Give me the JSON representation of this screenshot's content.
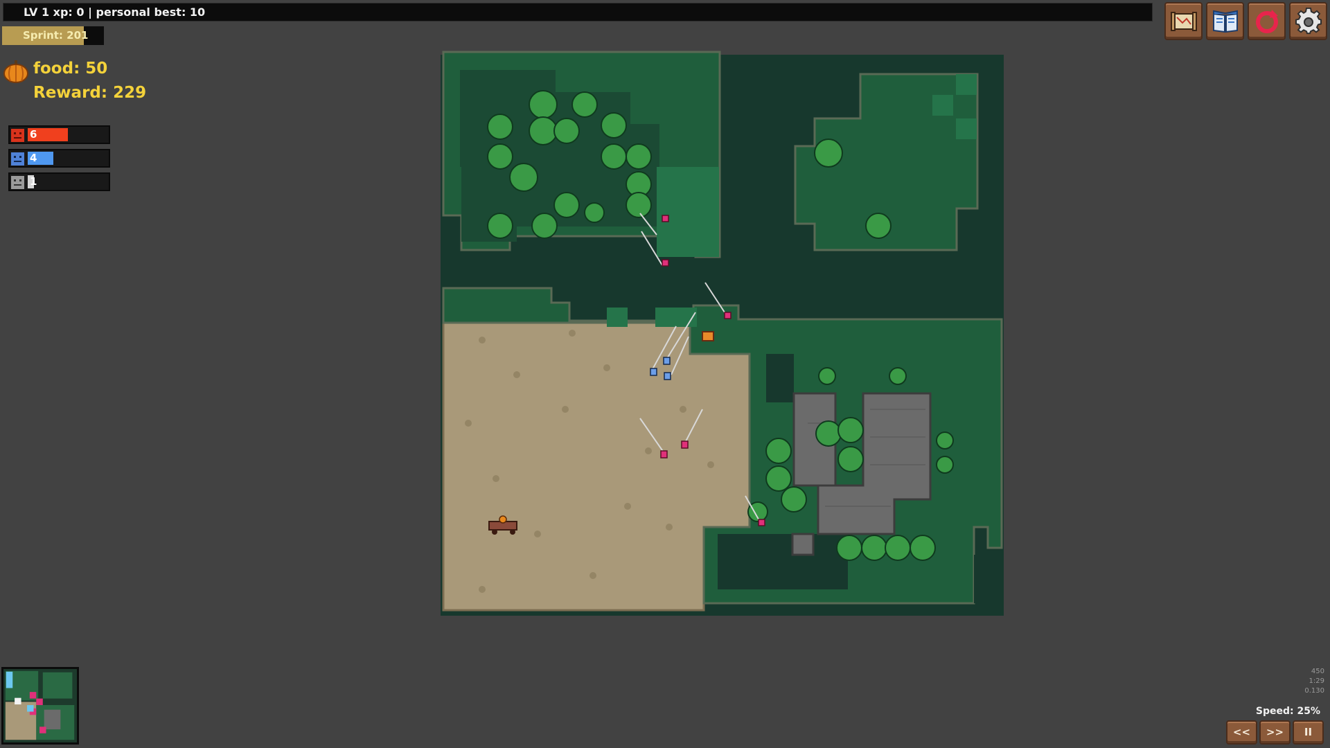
{
  "hud": {
    "level_text": "LV 1 xp: 0  |  personal best: 10",
    "sprint_text": "Sprint: 201",
    "sprint_fraction": 0.8,
    "food_text": "food: 50",
    "reward_text": "Reward: 229"
  },
  "teams": [
    {
      "name": "red",
      "value": "6",
      "fraction": 0.5,
      "color": "#f0401e",
      "face_color": "#d9331c"
    },
    {
      "name": "blue",
      "value": "4",
      "fraction": 0.32,
      "color": "#4f98f0",
      "face_color": "#4f82d8"
    },
    {
      "name": "gray",
      "value": "1",
      "fraction": 0.08,
      "color": "#d6d6d6",
      "face_color": "#9a9a9a"
    }
  ],
  "toolbar": {
    "buttons": [
      {
        "name": "map-scroll-icon"
      },
      {
        "name": "book-icon"
      },
      {
        "name": "restart-icon"
      },
      {
        "name": "gear-icon"
      }
    ]
  },
  "footer": {
    "stats": [
      "450",
      "1:29",
      "0.130"
    ],
    "speed_text": "Speed: 25%",
    "rewind_label": "<<",
    "forward_label": ">>",
    "pause_label": "II"
  },
  "colors": {
    "background": "#424242",
    "grass": "#1f5e3c",
    "dark_ground": "#17382d",
    "dirt": "#a99979",
    "rock": "#6b6b6b",
    "red_unit": "#e0307a",
    "blue_unit": "#6c9ee8"
  }
}
